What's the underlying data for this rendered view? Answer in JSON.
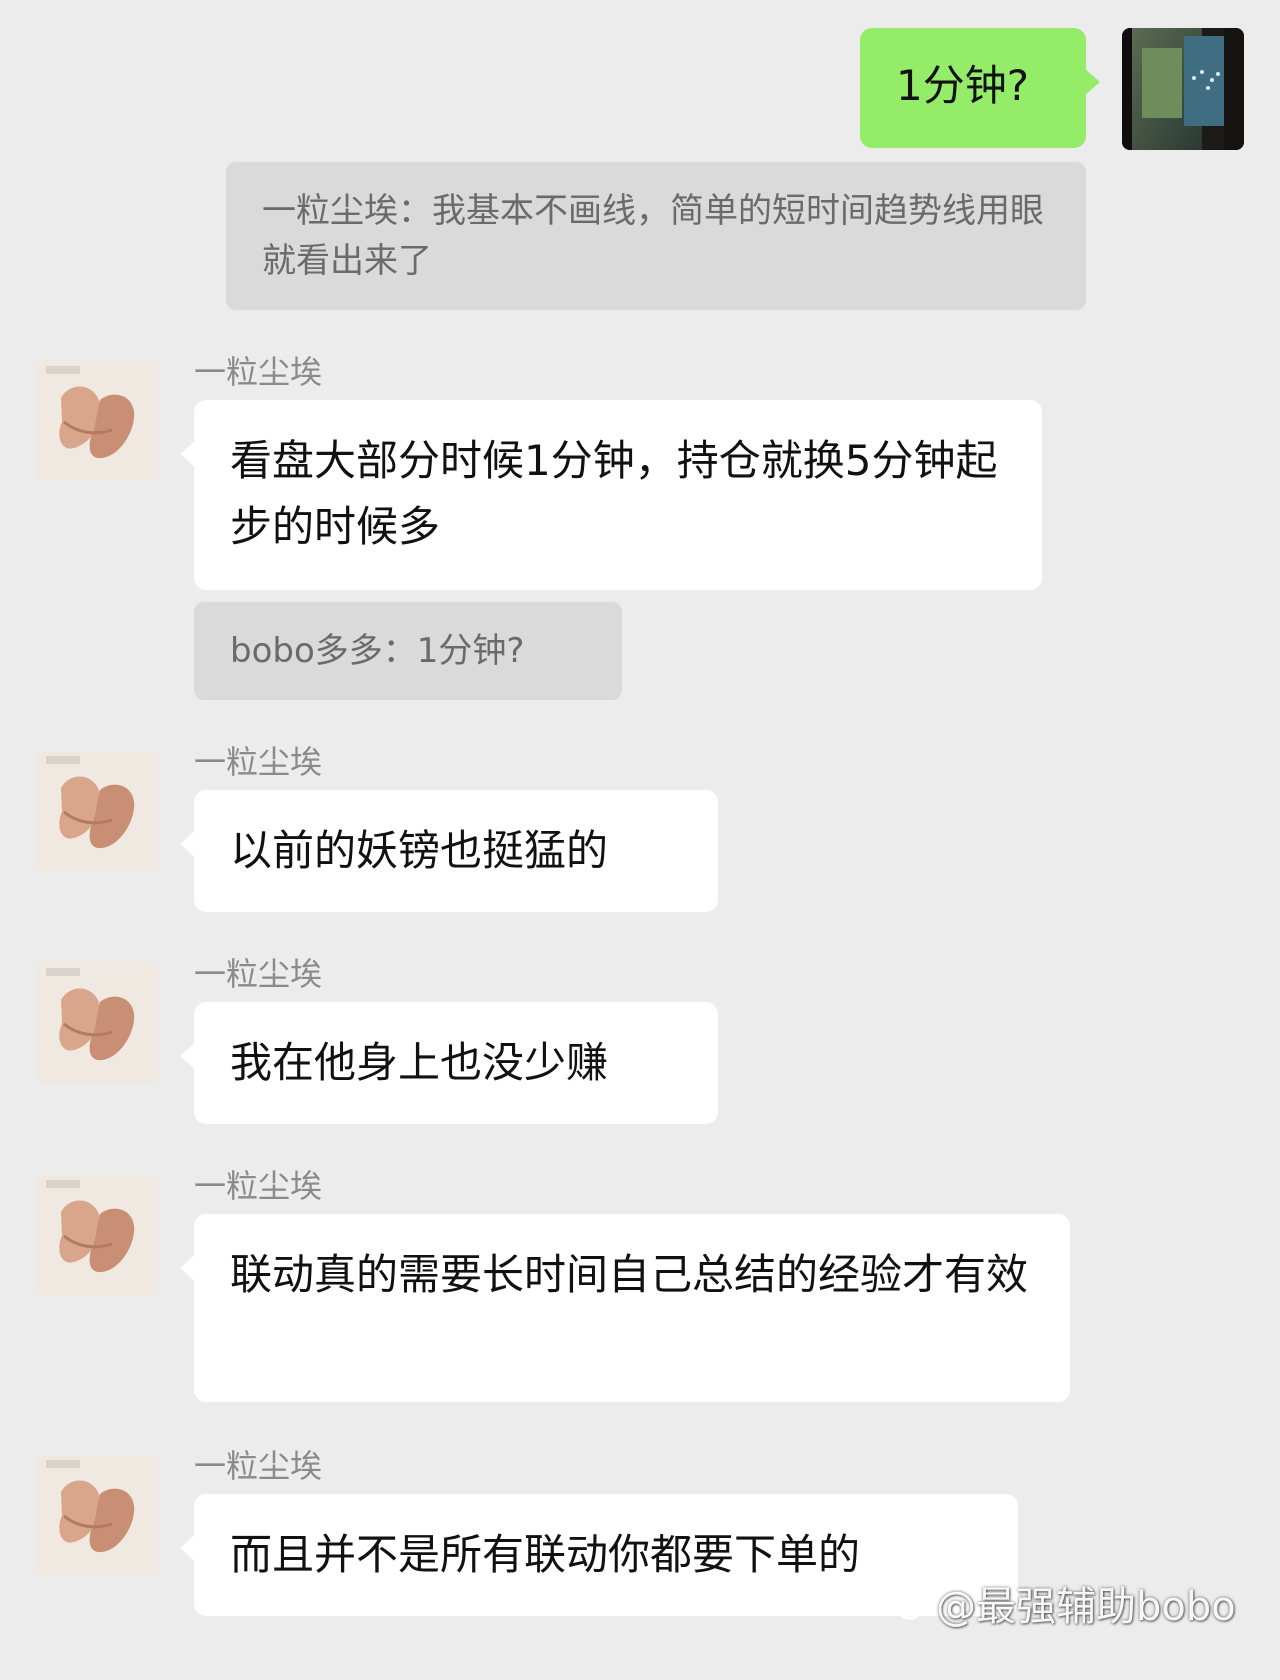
{
  "self": {
    "message": "1分钟?"
  },
  "quote_top": {
    "text": "一粒尘埃：我基本不画线，简单的短时间趋势线用眼就看出来了"
  },
  "messages": [
    {
      "sender": "一粒尘埃",
      "text": "看盘大部分时候1分钟，持仓就换5分钟起步的时候多",
      "quote": "bobo多多：1分钟?"
    },
    {
      "sender": "一粒尘埃",
      "text": "以前的妖镑也挺猛的"
    },
    {
      "sender": "一粒尘埃",
      "text": "我在他身上也没少赚"
    },
    {
      "sender": "一粒尘埃",
      "text": "联动真的需要长时间自己总结的经验才有效"
    },
    {
      "sender": "一粒尘埃",
      "text": "而且并不是所有联动你都要下单的"
    }
  ],
  "watermark": {
    "text": "@最强辅助bobo",
    "icon": "weibo-logo-icon"
  },
  "colors": {
    "background": "#ececec",
    "self_bubble": "#95ec69",
    "other_bubble": "#ffffff",
    "quote_bg": "#dadada"
  }
}
